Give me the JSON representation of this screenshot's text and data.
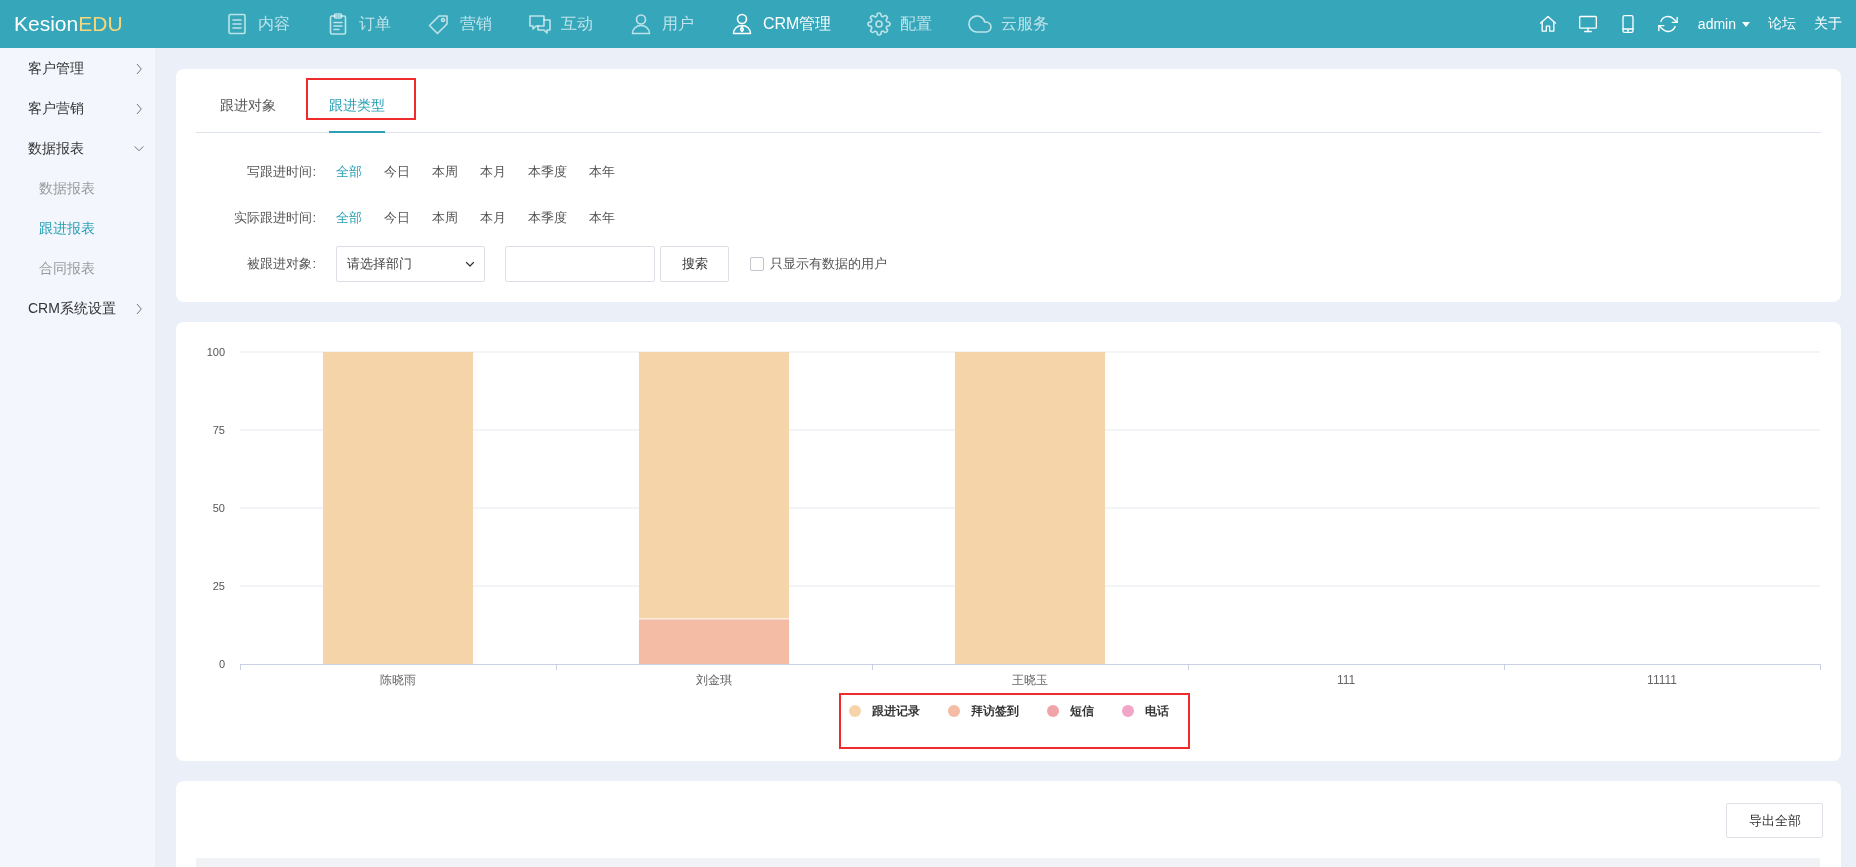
{
  "header": {
    "logo": {
      "name": "Kesion",
      "suffix": "EDU"
    },
    "nav": [
      {
        "label": "内容",
        "selected": false
      },
      {
        "label": "订单",
        "selected": false
      },
      {
        "label": "营销",
        "selected": false
      },
      {
        "label": "互动",
        "selected": false
      },
      {
        "label": "用户",
        "selected": false
      },
      {
        "label": "CRM管理",
        "selected": true
      },
      {
        "label": "配置",
        "selected": false
      },
      {
        "label": "云服务",
        "selected": false
      }
    ],
    "user_menu": "admin",
    "links": [
      "论坛",
      "关于"
    ]
  },
  "sidebar": {
    "items": [
      {
        "label": "客户管理",
        "expanded": false
      },
      {
        "label": "客户营销",
        "expanded": false
      },
      {
        "label": "数据报表",
        "expanded": true,
        "children": [
          {
            "label": "数据报表",
            "selected": false
          },
          {
            "label": "跟进报表",
            "selected": true
          },
          {
            "label": "合同报表",
            "selected": false
          }
        ]
      },
      {
        "label": "CRM系统设置",
        "expanded": false
      }
    ]
  },
  "filter_panel": {
    "tabs": [
      {
        "label": "跟进对象",
        "selected": false,
        "annotated": false
      },
      {
        "label": "跟进类型",
        "selected": true,
        "annotated": true
      }
    ],
    "time_filters": [
      {
        "label": "写跟进时间:",
        "options": [
          {
            "label": "全部",
            "selected": true
          },
          {
            "label": "今日",
            "selected": false
          },
          {
            "label": "本周",
            "selected": false
          },
          {
            "label": "本月",
            "selected": false
          },
          {
            "label": "本季度",
            "selected": false
          },
          {
            "label": "本年",
            "selected": false
          }
        ]
      },
      {
        "label": "实际跟进时间:",
        "options": [
          {
            "label": "全部",
            "selected": true
          },
          {
            "label": "今日",
            "selected": false
          },
          {
            "label": "本周",
            "selected": false
          },
          {
            "label": "本月",
            "selected": false
          },
          {
            "label": "本季度",
            "selected": false
          },
          {
            "label": "本年",
            "selected": false
          }
        ]
      }
    ],
    "target_filter": {
      "label": "被跟进对象:",
      "department_select": "请选择部门",
      "search_button": "搜索",
      "only_with_data": {
        "label": "只显示有数据的用户",
        "checked": false
      }
    }
  },
  "chart_panel": {
    "chart_data": {
      "type": "bar",
      "stacked": true,
      "grid": true,
      "categories": [
        "陈晓雨",
        "刘金琪",
        "王晓玉",
        "111",
        "11111"
      ],
      "series": [
        {
          "name": "跟进记录",
          "color": "#f6d4a9",
          "values": [
            100,
            85.7,
            100,
            0,
            0
          ]
        },
        {
          "name": "拜访签到",
          "color": "#f4bba5",
          "values": [
            0,
            14.3,
            0,
            0,
            0
          ]
        },
        {
          "name": "短信",
          "color": "#f2a3a9",
          "values": [
            0,
            0,
            0,
            0,
            0
          ]
        },
        {
          "name": "电话",
          "color": "#f3a5c7",
          "values": [
            0,
            0,
            0,
            0,
            0
          ]
        }
      ],
      "ylim": [
        0,
        100
      ],
      "yticks": [
        0,
        25,
        50,
        75,
        100
      ]
    },
    "legend_annotated": true
  },
  "records_panel": {
    "export_button": "导出全部"
  }
}
